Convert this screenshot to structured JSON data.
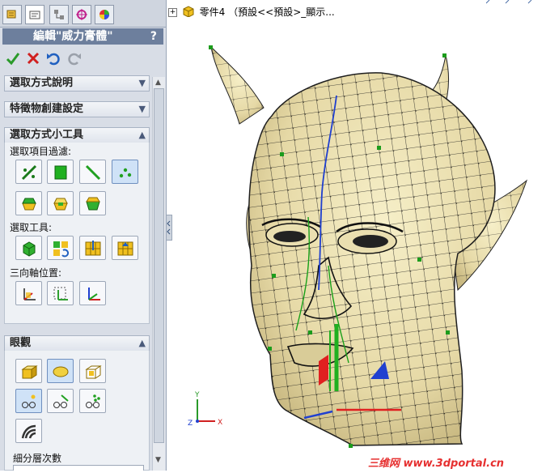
{
  "header": {
    "title": "編輯\"威力膏體\"",
    "help": "?"
  },
  "sections": {
    "s1": "選取方式說明",
    "s2": "特徵物創建設定",
    "s3": "選取方式小工具",
    "s4": "眼觀"
  },
  "labels": {
    "filter": "選取項目過濾:",
    "tools": "選取工具:",
    "triad": "三向軸位置:",
    "subdiv": "細分層次數"
  },
  "tree": {
    "label": "零件4 （預設<<預設>_顯示..."
  },
  "watermark": {
    "cn": "三维网",
    "url": "www.3dportal.cn"
  },
  "colors": {
    "accent": "#6d7f9d",
    "model": "#eadfb0",
    "edge": "#111111",
    "spline": "#1f3fcf"
  }
}
